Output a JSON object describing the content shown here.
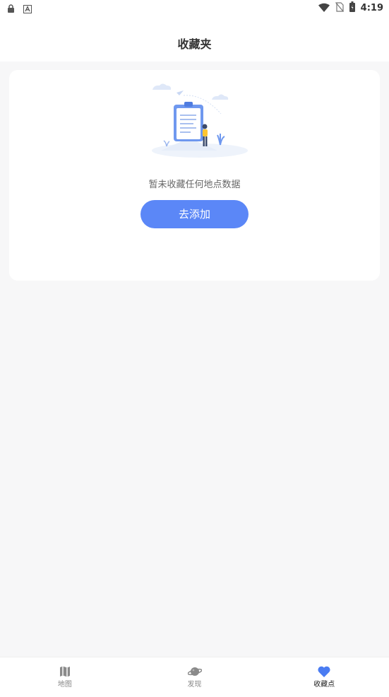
{
  "status_bar": {
    "time": "4:19",
    "icons": [
      "lock-icon",
      "app-notification-icon",
      "wifi-icon",
      "no-sim-icon",
      "battery-icon"
    ]
  },
  "header": {
    "title": "收藏夹"
  },
  "empty_state": {
    "illustration": "clipboard-person-illustration",
    "message": "暂未收藏任何地点数据",
    "button_label": "去添加"
  },
  "tabbar": {
    "items": [
      {
        "label": "地图",
        "icon": "map-icon",
        "active": false
      },
      {
        "label": "发现",
        "icon": "planet-icon",
        "active": false
      },
      {
        "label": "收藏点",
        "icon": "heart-icon",
        "active": true
      }
    ]
  },
  "colors": {
    "accent": "#5b87f7",
    "background": "#f7f7f8",
    "card": "#ffffff",
    "active_icon": "#4a7cf2",
    "inactive_icon": "#8a8a8a"
  }
}
